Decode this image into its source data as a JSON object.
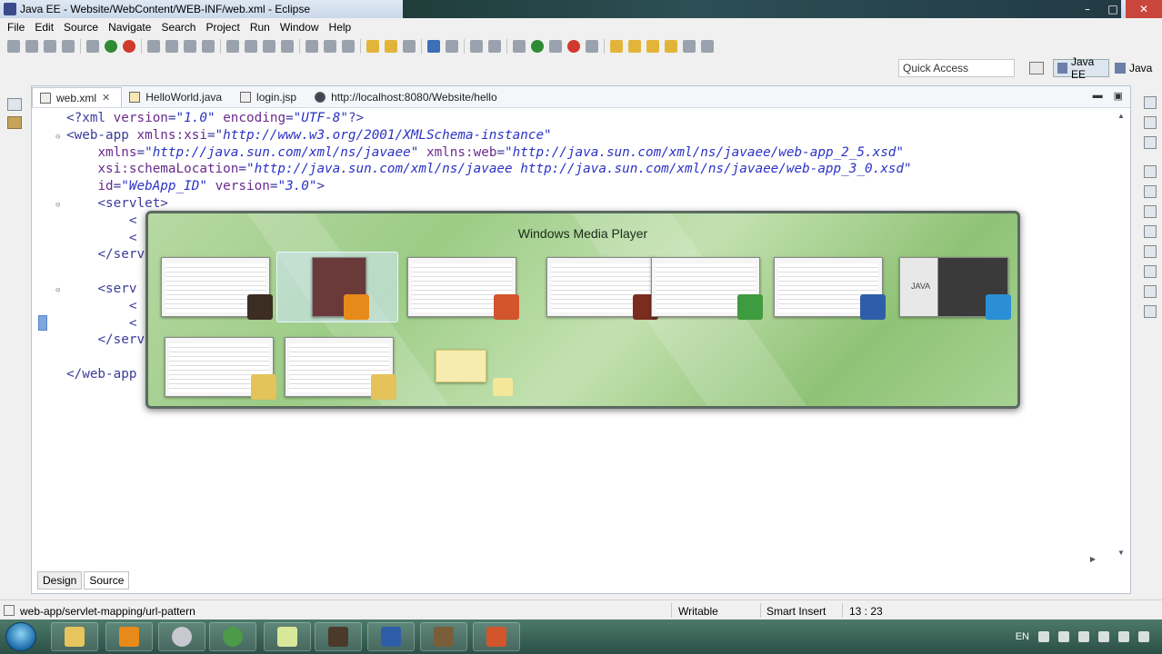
{
  "window": {
    "title": "Java EE - Website/WebContent/WEB-INF/web.xml - Eclipse",
    "minimize": "–",
    "maximize": "□",
    "close": "✕"
  },
  "menu": [
    "File",
    "Edit",
    "Source",
    "Navigate",
    "Search",
    "Project",
    "Run",
    "Window",
    "Help"
  ],
  "quick_access": {
    "placeholder": "Quick Access"
  },
  "perspectives": [
    {
      "label": "Java EE",
      "active": true,
      "icon": "javaee-perspective-icon"
    },
    {
      "label": "Java",
      "active": false,
      "icon": "java-perspective-icon"
    }
  ],
  "editor_tabs": [
    {
      "label": "web.xml",
      "icon": "xml-file-icon",
      "active": true,
      "close": "✕"
    },
    {
      "label": "HelloWorld.java",
      "icon": "java-file-icon",
      "active": false
    },
    {
      "label": "login.jsp",
      "icon": "jsp-file-icon",
      "active": false
    },
    {
      "label": "http://localhost:8080/Website/hello",
      "icon": "browser-globe-icon",
      "active": false
    }
  ],
  "code_lines": [
    {
      "indent": "",
      "segments": [
        [
          "pi",
          "<?xml "
        ],
        [
          "attr",
          "version"
        ],
        [
          "pi",
          "="
        ],
        [
          "val",
          "\"1.0\""
        ],
        [
          "pi",
          " "
        ],
        [
          "attr",
          "encoding"
        ],
        [
          "pi",
          "="
        ],
        [
          "val",
          "\"UTF-8\""
        ],
        [
          "pi",
          "?>"
        ]
      ],
      "fold": ""
    },
    {
      "indent": "",
      "segments": [
        [
          "tag",
          "<web-app "
        ],
        [
          "attr",
          "xmlns:xsi"
        ],
        [
          "tag",
          "="
        ],
        [
          "val",
          "\"http://www.w3.org/2001/XMLSchema-instance\""
        ]
      ],
      "fold": "⊖"
    },
    {
      "indent": "    ",
      "segments": [
        [
          "attr",
          "xmlns"
        ],
        [
          "tag",
          "="
        ],
        [
          "val",
          "\"http://java.sun.com/xml/ns/javaee\""
        ],
        [
          "tag",
          " "
        ],
        [
          "attr",
          "xmlns:web"
        ],
        [
          "tag",
          "="
        ],
        [
          "val",
          "\"http://java.sun.com/xml/ns/javaee/web-app_2_5.xsd\""
        ]
      ],
      "fold": ""
    },
    {
      "indent": "    ",
      "segments": [
        [
          "attr",
          "xsi:schemaLocation"
        ],
        [
          "tag",
          "="
        ],
        [
          "val",
          "\"http://java.sun.com/xml/ns/javaee http://java.sun.com/xml/ns/javaee/web-app_3_0.xsd\""
        ]
      ],
      "fold": ""
    },
    {
      "indent": "    ",
      "segments": [
        [
          "attr",
          "id"
        ],
        [
          "tag",
          "="
        ],
        [
          "val",
          "\"WebApp_ID\""
        ],
        [
          "tag",
          " "
        ],
        [
          "attr",
          "version"
        ],
        [
          "tag",
          "="
        ],
        [
          "val",
          "\"3.0\""
        ],
        [
          "tag",
          ">"
        ]
      ],
      "fold": ""
    },
    {
      "indent": "    ",
      "segments": [
        [
          "tag",
          "<servlet>"
        ]
      ],
      "fold": "⊖"
    },
    {
      "indent": "        ",
      "segments": [
        [
          "tag",
          "<"
        ]
      ],
      "fold": ""
    },
    {
      "indent": "        ",
      "segments": [
        [
          "tag",
          "<"
        ]
      ],
      "fold": ""
    },
    {
      "indent": "    ",
      "segments": [
        [
          "tag",
          "</serv"
        ]
      ],
      "fold": ""
    },
    {
      "indent": "",
      "segments": [],
      "fold": ""
    },
    {
      "indent": "    ",
      "segments": [
        [
          "tag",
          "<serv"
        ]
      ],
      "fold": "⊖"
    },
    {
      "indent": "        ",
      "segments": [
        [
          "tag",
          "<"
        ]
      ],
      "fold": ""
    },
    {
      "indent": "        ",
      "segments": [
        [
          "tag",
          "<"
        ]
      ],
      "fold": ""
    },
    {
      "indent": "    ",
      "segments": [
        [
          "tag",
          "</serv"
        ]
      ],
      "fold": ""
    },
    {
      "indent": "",
      "segments": [],
      "fold": ""
    },
    {
      "indent": "",
      "segments": [
        [
          "tag",
          "</web-app"
        ]
      ],
      "fold": ""
    }
  ],
  "editor_bottom_tabs": [
    {
      "label": "Design",
      "selected": false
    },
    {
      "label": "Source",
      "selected": true
    }
  ],
  "status": {
    "path": "web-app/servlet-mapping/url-pattern",
    "mode": "Writable",
    "insert": "Smart Insert",
    "position": "13 : 23"
  },
  "switcher": {
    "title": "Windows Media Player",
    "windows": [
      {
        "name": "eclipse-window",
        "icon": "eclipse-javaee-icon",
        "badge_color": "#3b2d22"
      },
      {
        "name": "windows-media-player-window",
        "icon": "media-player-icon",
        "badge_color": "#e88a1a",
        "selected": true
      },
      {
        "name": "powerpoint-window",
        "icon": "powerpoint-icon",
        "badge_color": "#d2552b"
      },
      {
        "name": "gimp-window",
        "icon": "gimp-icon",
        "badge_color": "#7a2d1e"
      },
      {
        "name": "chrome-window",
        "icon": "chrome-icon",
        "badge_color": "#3f9b3f"
      },
      {
        "name": "word-window",
        "icon": "word-icon",
        "badge_color": "#2f5ea8"
      },
      {
        "name": "java-installer-window",
        "icon": "java-window-icon",
        "badge_color": "#2b8fd6",
        "thumb_text": "JAVA"
      },
      {
        "name": "explorer-window-1",
        "icon": "folder-icon",
        "badge_color": "#e3c35a"
      },
      {
        "name": "explorer-window-2",
        "icon": "folder-icon",
        "badge_color": "#e3c35a"
      },
      {
        "name": "desktop",
        "icon": "desktop-icon",
        "badge_color": "#f5e79a"
      }
    ]
  },
  "taskbar": {
    "items": [
      {
        "name": "explorer",
        "icon": "folder-icon",
        "color": "#e6c55c"
      },
      {
        "name": "media-player",
        "icon": "media-player-icon",
        "color": "#e88a1a"
      },
      {
        "name": "itunes",
        "icon": "itunes-icon",
        "color": "#c8c8d0"
      },
      {
        "name": "chrome",
        "icon": "chrome-icon",
        "color": "#4c9b48"
      },
      {
        "name": "sticky-notes",
        "icon": "sticky-notes-icon",
        "color": "#d7e89a"
      },
      {
        "name": "eclipse",
        "icon": "eclipse-javaee-icon",
        "color": "#4b3a2a"
      },
      {
        "name": "word",
        "icon": "word-icon",
        "color": "#2f5ea8"
      },
      {
        "name": "gimp",
        "icon": "gimp-icon",
        "color": "#7a5e3a"
      },
      {
        "name": "powerpoint",
        "icon": "powerpoint-icon",
        "color": "#d2552b"
      }
    ],
    "language": "EN"
  }
}
